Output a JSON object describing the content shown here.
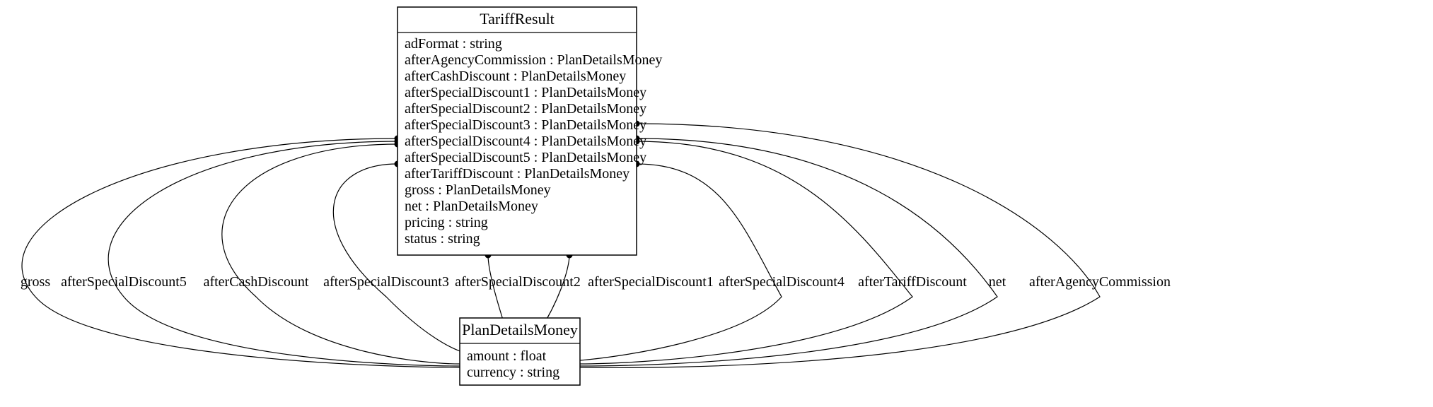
{
  "classes": {
    "tariffResult": {
      "name": "TariffResult",
      "attributes": [
        "adFormat : string",
        "afterAgencyCommission : PlanDetailsMoney",
        "afterCashDiscount : PlanDetailsMoney",
        "afterSpecialDiscount1 : PlanDetailsMoney",
        "afterSpecialDiscount2 : PlanDetailsMoney",
        "afterSpecialDiscount3 : PlanDetailsMoney",
        "afterSpecialDiscount4 : PlanDetailsMoney",
        "afterSpecialDiscount5 : PlanDetailsMoney",
        "afterTariffDiscount : PlanDetailsMoney",
        "gross : PlanDetailsMoney",
        "net : PlanDetailsMoney",
        "pricing : string",
        "status : string"
      ]
    },
    "planDetailsMoney": {
      "name": "PlanDetailsMoney",
      "attributes": [
        "amount : float",
        "currency : string"
      ]
    }
  },
  "edges": {
    "gross": "gross",
    "afterSpecialDiscount5": "afterSpecialDiscount5",
    "afterCashDiscount": "afterCashDiscount",
    "afterSpecialDiscount3": "afterSpecialDiscount3",
    "afterSpecialDiscount2": "afterSpecialDiscount2",
    "afterSpecialDiscount1": "afterSpecialDiscount1",
    "afterSpecialDiscount4": "afterSpecialDiscount4",
    "afterTariffDiscount": "afterTariffDiscount",
    "net": "net",
    "afterAgencyCommission": "afterAgencyCommission"
  }
}
